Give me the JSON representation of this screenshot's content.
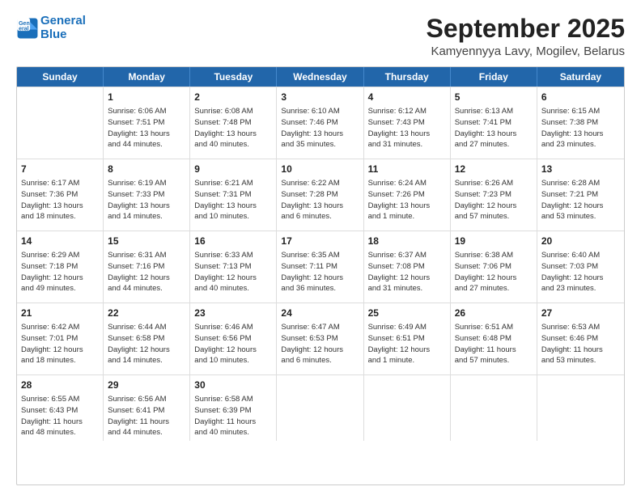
{
  "header": {
    "logo_line1": "General",
    "logo_line2": "Blue",
    "month": "September 2025",
    "location": "Kamyennyya Lavy, Mogilev, Belarus"
  },
  "weekdays": [
    "Sunday",
    "Monday",
    "Tuesday",
    "Wednesday",
    "Thursday",
    "Friday",
    "Saturday"
  ],
  "rows": [
    [
      {
        "day": "",
        "info": ""
      },
      {
        "day": "1",
        "info": "Sunrise: 6:06 AM\nSunset: 7:51 PM\nDaylight: 13 hours\nand 44 minutes."
      },
      {
        "day": "2",
        "info": "Sunrise: 6:08 AM\nSunset: 7:48 PM\nDaylight: 13 hours\nand 40 minutes."
      },
      {
        "day": "3",
        "info": "Sunrise: 6:10 AM\nSunset: 7:46 PM\nDaylight: 13 hours\nand 35 minutes."
      },
      {
        "day": "4",
        "info": "Sunrise: 6:12 AM\nSunset: 7:43 PM\nDaylight: 13 hours\nand 31 minutes."
      },
      {
        "day": "5",
        "info": "Sunrise: 6:13 AM\nSunset: 7:41 PM\nDaylight: 13 hours\nand 27 minutes."
      },
      {
        "day": "6",
        "info": "Sunrise: 6:15 AM\nSunset: 7:38 PM\nDaylight: 13 hours\nand 23 minutes."
      }
    ],
    [
      {
        "day": "7",
        "info": "Sunrise: 6:17 AM\nSunset: 7:36 PM\nDaylight: 13 hours\nand 18 minutes."
      },
      {
        "day": "8",
        "info": "Sunrise: 6:19 AM\nSunset: 7:33 PM\nDaylight: 13 hours\nand 14 minutes."
      },
      {
        "day": "9",
        "info": "Sunrise: 6:21 AM\nSunset: 7:31 PM\nDaylight: 13 hours\nand 10 minutes."
      },
      {
        "day": "10",
        "info": "Sunrise: 6:22 AM\nSunset: 7:28 PM\nDaylight: 13 hours\nand 6 minutes."
      },
      {
        "day": "11",
        "info": "Sunrise: 6:24 AM\nSunset: 7:26 PM\nDaylight: 13 hours\nand 1 minute."
      },
      {
        "day": "12",
        "info": "Sunrise: 6:26 AM\nSunset: 7:23 PM\nDaylight: 12 hours\nand 57 minutes."
      },
      {
        "day": "13",
        "info": "Sunrise: 6:28 AM\nSunset: 7:21 PM\nDaylight: 12 hours\nand 53 minutes."
      }
    ],
    [
      {
        "day": "14",
        "info": "Sunrise: 6:29 AM\nSunset: 7:18 PM\nDaylight: 12 hours\nand 49 minutes."
      },
      {
        "day": "15",
        "info": "Sunrise: 6:31 AM\nSunset: 7:16 PM\nDaylight: 12 hours\nand 44 minutes."
      },
      {
        "day": "16",
        "info": "Sunrise: 6:33 AM\nSunset: 7:13 PM\nDaylight: 12 hours\nand 40 minutes."
      },
      {
        "day": "17",
        "info": "Sunrise: 6:35 AM\nSunset: 7:11 PM\nDaylight: 12 hours\nand 36 minutes."
      },
      {
        "day": "18",
        "info": "Sunrise: 6:37 AM\nSunset: 7:08 PM\nDaylight: 12 hours\nand 31 minutes."
      },
      {
        "day": "19",
        "info": "Sunrise: 6:38 AM\nSunset: 7:06 PM\nDaylight: 12 hours\nand 27 minutes."
      },
      {
        "day": "20",
        "info": "Sunrise: 6:40 AM\nSunset: 7:03 PM\nDaylight: 12 hours\nand 23 minutes."
      }
    ],
    [
      {
        "day": "21",
        "info": "Sunrise: 6:42 AM\nSunset: 7:01 PM\nDaylight: 12 hours\nand 18 minutes."
      },
      {
        "day": "22",
        "info": "Sunrise: 6:44 AM\nSunset: 6:58 PM\nDaylight: 12 hours\nand 14 minutes."
      },
      {
        "day": "23",
        "info": "Sunrise: 6:46 AM\nSunset: 6:56 PM\nDaylight: 12 hours\nand 10 minutes."
      },
      {
        "day": "24",
        "info": "Sunrise: 6:47 AM\nSunset: 6:53 PM\nDaylight: 12 hours\nand 6 minutes."
      },
      {
        "day": "25",
        "info": "Sunrise: 6:49 AM\nSunset: 6:51 PM\nDaylight: 12 hours\nand 1 minute."
      },
      {
        "day": "26",
        "info": "Sunrise: 6:51 AM\nSunset: 6:48 PM\nDaylight: 11 hours\nand 57 minutes."
      },
      {
        "day": "27",
        "info": "Sunrise: 6:53 AM\nSunset: 6:46 PM\nDaylight: 11 hours\nand 53 minutes."
      }
    ],
    [
      {
        "day": "28",
        "info": "Sunrise: 6:55 AM\nSunset: 6:43 PM\nDaylight: 11 hours\nand 48 minutes."
      },
      {
        "day": "29",
        "info": "Sunrise: 6:56 AM\nSunset: 6:41 PM\nDaylight: 11 hours\nand 44 minutes."
      },
      {
        "day": "30",
        "info": "Sunrise: 6:58 AM\nSunset: 6:39 PM\nDaylight: 11 hours\nand 40 minutes."
      },
      {
        "day": "",
        "info": ""
      },
      {
        "day": "",
        "info": ""
      },
      {
        "day": "",
        "info": ""
      },
      {
        "day": "",
        "info": ""
      }
    ]
  ]
}
